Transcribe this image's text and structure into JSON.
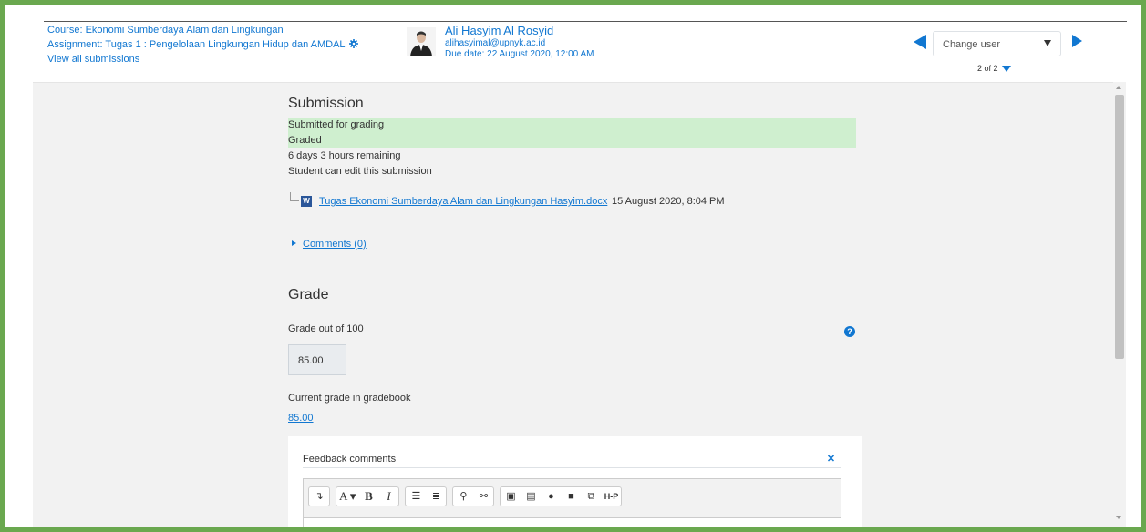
{
  "header": {
    "course_link": "Course: Ekonomi Sumberdaya Alam dan Lingkungan",
    "assignment_link": "Assignment: Tugas 1 : Pengelolaan Lingkungan Hidup dan AMDAL",
    "view_all_link": "View all submissions",
    "user": {
      "name": "Ali Hasyim Al Rosyid",
      "email": "alihasyimal@upnyk.ac.id",
      "due_date": "Due date: 22 August 2020, 12:00 AM"
    },
    "change_user": {
      "selected": "Change user"
    },
    "pager": "2 of 2"
  },
  "submission": {
    "heading": "Submission",
    "status_submitted": "Submitted for grading",
    "status_graded": "Graded",
    "time_remaining": "6 days 3 hours remaining",
    "edit_note": "Student can edit this submission",
    "file_name": "Tugas Ekonomi Sumberdaya Alam dan Lingkungan Hasyim.docx",
    "file_date": "15 August 2020, 8:04 PM",
    "comments_link": "Comments (0)"
  },
  "grade": {
    "heading": "Grade",
    "grade_out_label": "Grade out of 100",
    "grade_value": "85.00",
    "current_label": "Current grade in gradebook",
    "current_value": "85.00"
  },
  "feedback": {
    "title": "Feedback comments",
    "toolbar": {
      "bold": "B",
      "italic": "I",
      "font": "A",
      "h5p": "H-P"
    }
  },
  "colors": {
    "accent": "#1177d1",
    "status_bg": "#cfefcf",
    "border_frame": "#6aa84f"
  }
}
